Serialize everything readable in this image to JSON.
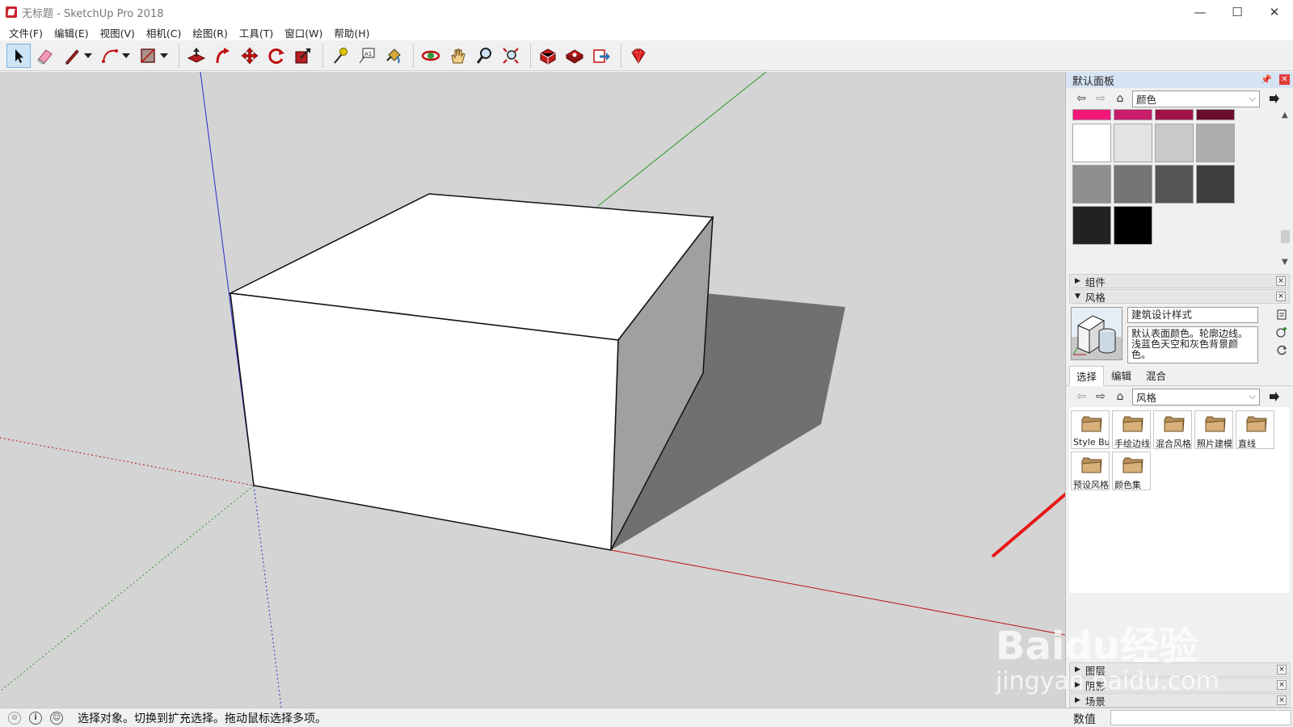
{
  "window": {
    "title": "无标题 - SketchUp Pro 2018",
    "minimize": "—",
    "maximize": "☐",
    "close": "✕"
  },
  "menu": [
    "文件(F)",
    "编辑(E)",
    "视图(V)",
    "相机(C)",
    "绘图(R)",
    "工具(T)",
    "窗口(W)",
    "帮助(H)"
  ],
  "toolbar": {
    "tools": [
      "select-arrow-icon",
      "eraser-icon",
      "pencil-line-icon",
      "arc-icon",
      "rectangle-icon",
      "push-pull-icon",
      "follow-me-icon",
      "move-icon",
      "rotate-icon",
      "scale-icon",
      "tape-measure-icon",
      "text-icon",
      "paint-bucket-icon",
      "orbit-icon",
      "pan-icon",
      "zoom-icon",
      "zoom-extents-icon",
      "warehouse-icon",
      "extension-warehouse-icon",
      "send-to-layout-icon",
      "ruby-console-icon"
    ]
  },
  "tray": {
    "title": "默认面板",
    "materials": {
      "select_value": "颜色",
      "colors_top": [
        "#f4177a",
        "#c81d6b",
        "#9e1448",
        "#6b0d2e"
      ],
      "colors_gray": [
        "#ffffff",
        "#e3e3e3",
        "#c9c9c9",
        "#adadad",
        "#8f8f8f",
        "#757575",
        "#555555",
        "#3d3d3d",
        "#222222",
        "#000000"
      ]
    },
    "components_label": "组件",
    "styles_label": "风格",
    "style": {
      "name": "建筑设计样式",
      "description": "默认表面颜色。轮廓边线。浅蓝色天空和灰色背景颜色。"
    },
    "tabs": [
      "选择",
      "编辑",
      "混合"
    ],
    "collection_value": "风格",
    "folders": [
      "Style Buil",
      "手绘边线",
      "混合风格",
      "照片建模",
      "直线",
      "预设风格",
      "颜色集"
    ],
    "bottom_sections": [
      "图层",
      "阴影",
      "场景"
    ]
  },
  "status": {
    "text": "选择对象。切换到扩充选择。拖动鼠标选择多项。",
    "measure_label": "数值",
    "measure_value": ""
  },
  "watermark": {
    "brand": "Baidu经验",
    "url": "jingyan.baidu.com"
  }
}
